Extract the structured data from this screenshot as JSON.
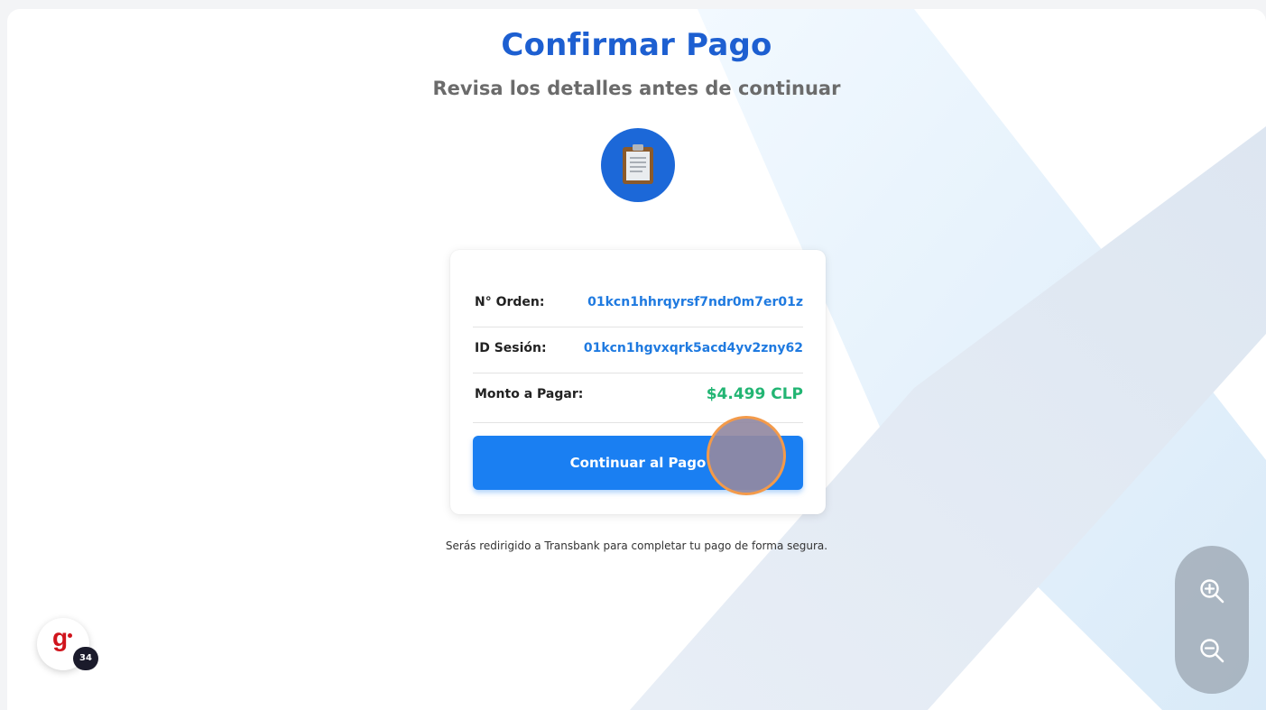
{
  "header": {
    "title": "Confirmar Pago",
    "subtitle": "Revisa los detalles antes de continuar"
  },
  "icons": {
    "header_icon": "clipboard-icon",
    "zoom_in": "zoom-in-icon",
    "zoom_out": "zoom-out-icon"
  },
  "details": {
    "order_label": "N° Orden:",
    "order_value": "01kcn1hhrqyrsf7ndr0m7er01z",
    "session_label": "ID Sesión:",
    "session_value": "01kcn1hgvxqrk5acd4yv2zny62",
    "amount_label": "Monto a Pagar:",
    "amount_value": "$4.499 CLP"
  },
  "actions": {
    "pay_button": "Continuar al Pago"
  },
  "footer_note": "Serás redirigido a Transbank para completar tu pago de forma segura.",
  "widget": {
    "logo_letter": "g",
    "badge_count": "34"
  },
  "colors": {
    "title": "#1d5fd1",
    "link_value": "#1f7ae0",
    "amount": "#22b573",
    "button": "#1a7ff2"
  }
}
